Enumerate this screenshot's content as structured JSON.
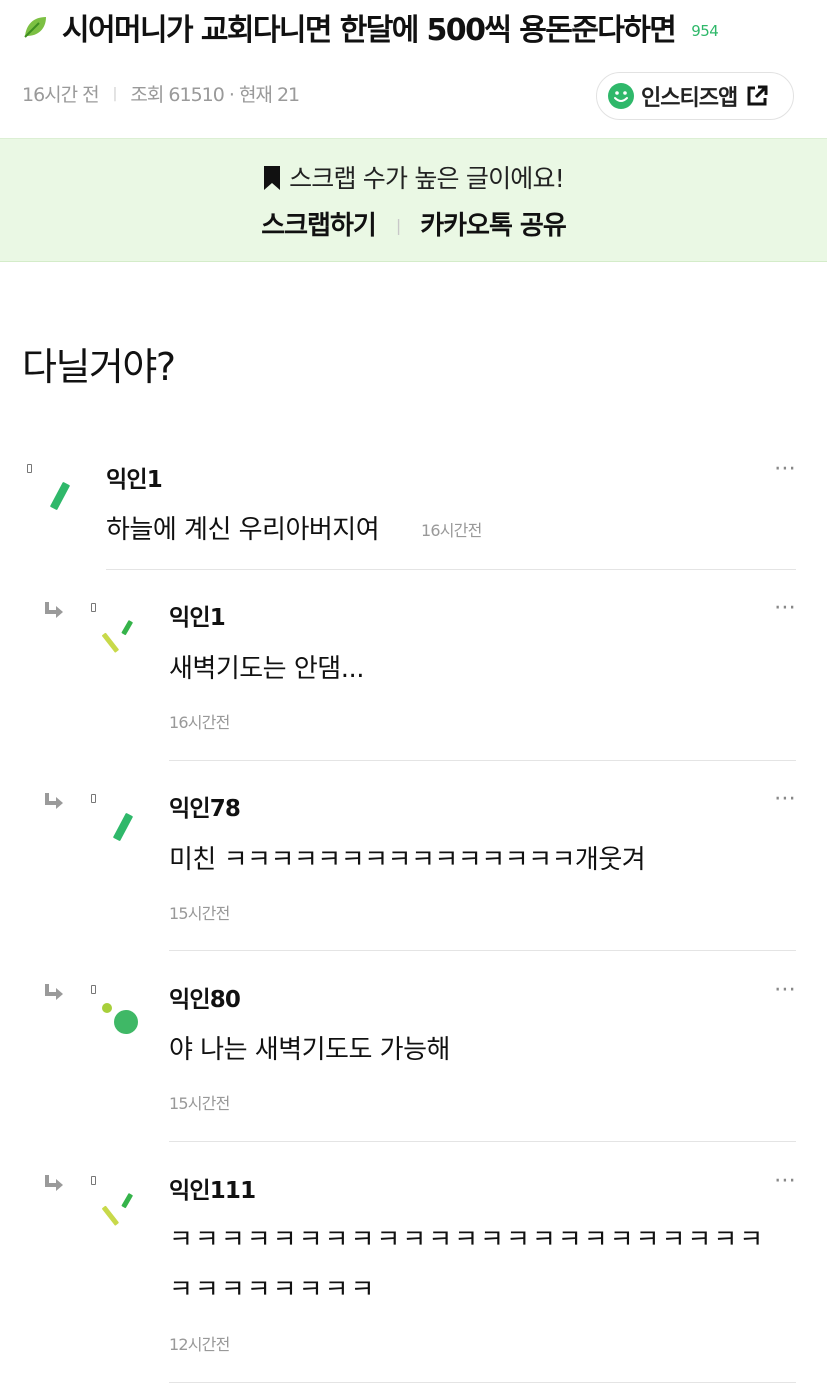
{
  "post": {
    "title": "시어머니가 교회다니면 한달에 500씩 용돈준다하면",
    "count": "954",
    "time": "16시간 전",
    "views": "조회 61510 · 현재 21",
    "body": "다닐거야?"
  },
  "app_button": {
    "label": "인스티즈앱"
  },
  "banner": {
    "message": "스크랩 수가 높은 글이에요!",
    "scrap": "스크랩하기",
    "kakao": "카카오톡 공유"
  },
  "comments": [
    {
      "author": "익인1",
      "text": "하늘에 계신 우리아버지여",
      "time": "16시간전",
      "reply": false
    },
    {
      "author": "익인1",
      "text": "새벽기도는 안댐...",
      "time": "16시간전",
      "reply": true
    },
    {
      "author": "익인78",
      "text": "미친 ㅋㅋㅋㅋㅋㅋㅋㅋㅋㅋㅋㅋㅋㅋㅋ개웃겨",
      "time": "15시간전",
      "reply": true
    },
    {
      "author": "익인80",
      "text": "야 나는 새벽기도도 가능해",
      "time": "15시간전",
      "reply": true
    },
    {
      "author": "익인111",
      "text": "ㅋㅋㅋㅋㅋㅋㅋㅋㅋㅋㅋㅋㅋㅋㅋㅋㅋㅋㅋㅋㅋㅋㅋ",
      "text2": "ㅋㅋㅋㅋㅋㅋㅋㅋ",
      "time": "12시간전",
      "reply": true
    }
  ],
  "more_icon": "more-horizontal-icon",
  "colors": {
    "accent": "#2fb86a",
    "banner_bg": "#eaf8e4"
  }
}
